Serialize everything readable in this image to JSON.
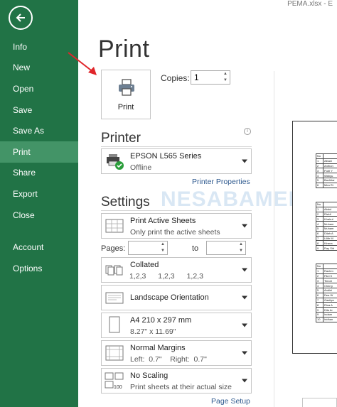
{
  "window": {
    "filename": "PEMA.xlsx - E"
  },
  "sidebar": {
    "items": [
      {
        "label": "Info"
      },
      {
        "label": "New"
      },
      {
        "label": "Open"
      },
      {
        "label": "Save"
      },
      {
        "label": "Save As"
      },
      {
        "label": "Print",
        "active": true
      },
      {
        "label": "Share"
      },
      {
        "label": "Export"
      },
      {
        "label": "Close"
      },
      {
        "label": "Account"
      },
      {
        "label": "Options"
      }
    ]
  },
  "main": {
    "title": "Print",
    "print_button": "Print",
    "copies_label": "Copies:",
    "copies_value": "1",
    "printer_heading": "Printer",
    "printer": {
      "name": "EPSON L565 Series",
      "status": "Offline",
      "icon": "printer-offline-icon"
    },
    "printer_properties": "Printer Properties",
    "settings_heading": "Settings",
    "settings": [
      {
        "title": "Print Active Sheets",
        "subtitle": "Only print the active sheets"
      },
      {
        "title": "Collated",
        "collate": [
          "1,2,3",
          "1,2,3",
          "1,2,3"
        ]
      },
      {
        "title": "Landscape Orientation"
      },
      {
        "title": "A4 210 x 297 mm",
        "subtitle": "8.27\" x 11.69\""
      },
      {
        "title": "Normal Margins",
        "subtitle": "Left:  0.7\"    Right:  0.7\""
      },
      {
        "title": "No Scaling",
        "subtitle": "Print sheets at their actual size"
      }
    ],
    "pages_label": "Pages:",
    "to_label": "to",
    "page_setup": "Page Setup"
  },
  "preview": {
    "table_header": "No",
    "groups": [
      {
        "rows": [
          [
            "1",
            "Albani"
          ],
          [
            "2",
            "Anthon"
          ],
          [
            "3",
            "Putri Y"
          ],
          [
            "4",
            "Wahyu"
          ],
          [
            "5",
            "Bachtiar"
          ],
          [
            "6",
            "Mira Ri"
          ]
        ]
      },
      {
        "rows": [
          [
            "1",
            "Abdul"
          ],
          [
            "2",
            "Rizkil"
          ],
          [
            "3",
            "Khairul"
          ],
          [
            "4",
            "Muham"
          ],
          [
            "5",
            "Muham"
          ],
          [
            "6",
            "Dilah A"
          ],
          [
            "7",
            "Lilith M"
          ],
          [
            "8",
            "Kirana"
          ],
          [
            "9",
            "Ray Sid"
          ]
        ]
      },
      {
        "rows": [
          [
            "1",
            "Rachm"
          ],
          [
            "2",
            "Fikri K"
          ],
          [
            "3",
            "Timoti"
          ],
          [
            "4",
            "Cherry"
          ],
          [
            "5",
            "Andini"
          ],
          [
            "6",
            "Dea W"
          ],
          [
            "7",
            "Gastiya"
          ],
          [
            "8",
            "Rina A"
          ],
          [
            "9",
            "Dila Ar"
          ],
          [
            "9",
            "Indam"
          ],
          [
            "10",
            "Iridhan"
          ]
        ]
      }
    ]
  },
  "watermark": "NESABAMEDIA",
  "colors": {
    "sidebar": "#217346",
    "sidebar_active": "#439467",
    "link": "#2f5a8f",
    "annotation_arrow": "#e0262b"
  }
}
